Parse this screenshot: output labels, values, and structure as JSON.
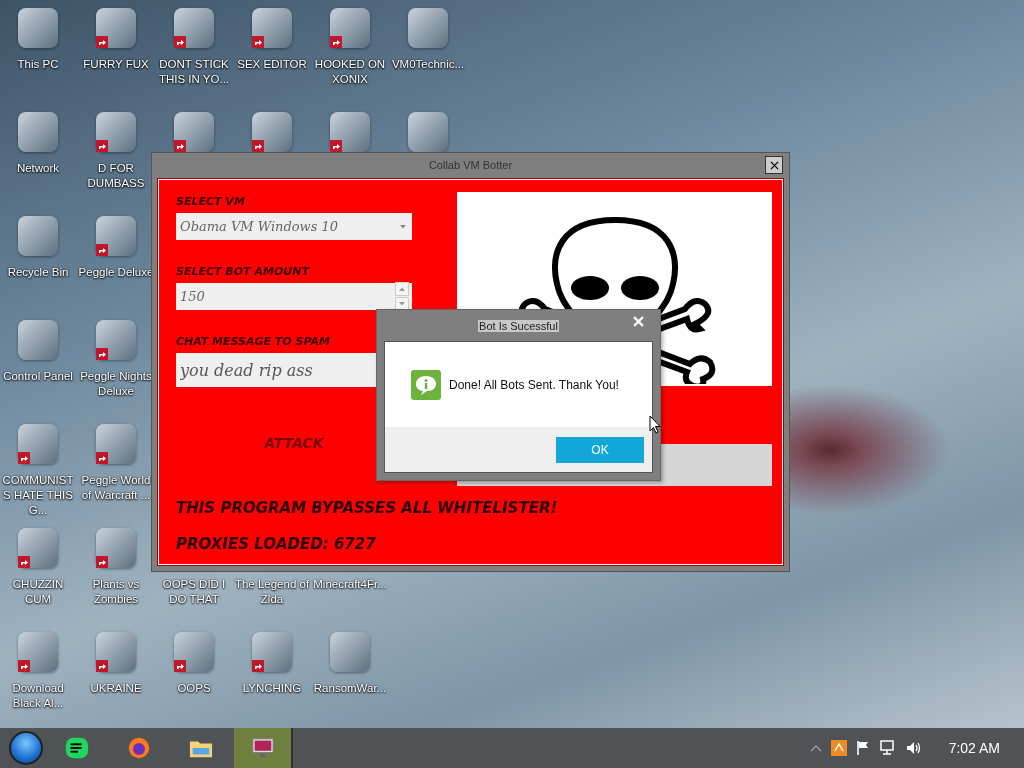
{
  "desktop": {
    "columns": [
      [
        {
          "label": "This PC",
          "shortcut": false
        },
        {
          "label": "Network",
          "shortcut": false
        },
        {
          "label": "Recycle Bin",
          "shortcut": false
        },
        {
          "label": "Control Panel",
          "shortcut": false
        },
        {
          "label": "COMMUNISTS HATE THIS G...",
          "shortcut": true
        },
        {
          "label": "CHUZZIN CUM",
          "shortcut": true
        },
        {
          "label": "Download Black Al...",
          "shortcut": true
        }
      ],
      [
        {
          "label": "FURRY FUX",
          "shortcut": true
        },
        {
          "label": "D FOR DUMBASS",
          "shortcut": true
        },
        {
          "label": "Peggle Deluxe",
          "shortcut": true
        },
        {
          "label": "Peggle Nights Deluxe",
          "shortcut": true
        },
        {
          "label": "Peggle World of Warcraft ...",
          "shortcut": true
        },
        {
          "label": "Plants vs Zombies",
          "shortcut": true
        },
        {
          "label": "UKRAINE",
          "shortcut": true
        }
      ],
      [
        {
          "label": "DONT STICK THIS IN YO...",
          "shortcut": true
        },
        {
          "shortcut": true
        },
        null,
        null,
        null,
        {
          "label": "OOPS DID I DO THAT",
          "icon_covered": true
        },
        {
          "label": "OOPS",
          "shortcut": true
        }
      ],
      [
        {
          "label": "SEX EDITOR",
          "shortcut": true
        },
        {
          "shortcut": true
        },
        null,
        null,
        null,
        {
          "label": "The Legend of Zlda",
          "icon_covered": true
        },
        {
          "label": "LYNCHING",
          "shortcut": true
        }
      ],
      [
        {
          "label": "HOOKED ON XONIX",
          "shortcut": true
        },
        {
          "shortcut": true
        },
        null,
        null,
        null,
        {
          "label": "Minecraft4Fr...",
          "icon_covered": true
        },
        {
          "label": "RansomWar...",
          "shortcut": false
        }
      ],
      [
        {
          "label": "VM0Technic...",
          "shortcut": false
        },
        {
          "shortcut": false
        }
      ]
    ]
  },
  "window": {
    "title": "Collab VM Botter",
    "vm_label": "SELECT VM",
    "vm_value": "Obama VM Windows 10",
    "amount_label": "SELECT BOT AMOUNT",
    "amount_value": "150",
    "message_label": "CHAT MESSAGE TO SPAM",
    "message_value": "you dead rip ass",
    "attack_button": "ATTACK",
    "notice": "THIS PROGRAM BYPASSES ALL WHITELISTER!",
    "proxies": "PROXIES LOADED: 6727"
  },
  "dialog": {
    "title": "Bot Is Sucessful",
    "message": "Done! All Bots Sent. Thank You!",
    "button": "OK"
  },
  "taskbar": {
    "apps": [
      {
        "selected": false
      },
      {
        "selected": false
      },
      {
        "selected": false
      },
      {
        "selected": true
      }
    ],
    "clock": "7:02 AM"
  }
}
